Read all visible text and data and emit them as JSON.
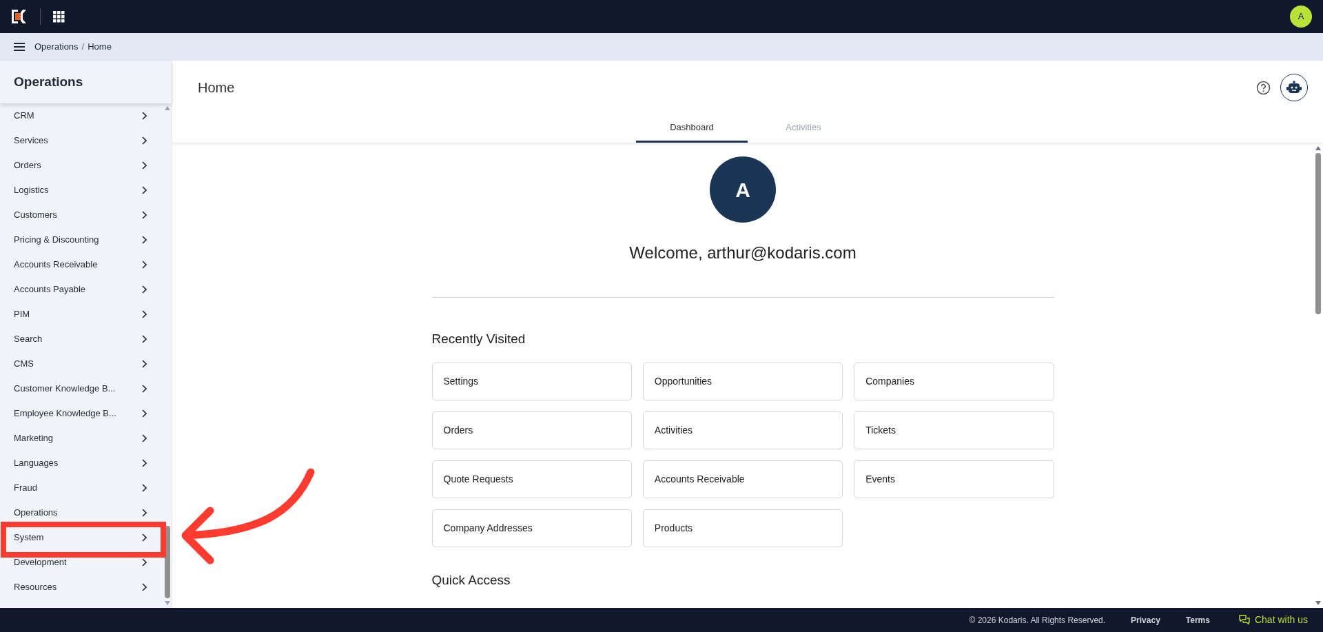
{
  "top_bar": {
    "user_initial": "A"
  },
  "breadcrumb": {
    "items": [
      "Operations",
      "Home"
    ],
    "separator": "/"
  },
  "sidebar": {
    "title": "Operations",
    "items": [
      "CRM",
      "Services",
      "Orders",
      "Logistics",
      "Customers",
      "Pricing & Discounting",
      "Accounts Receivable",
      "Accounts Payable",
      "PIM",
      "Search",
      "CMS",
      "Customer Knowledge B...",
      "Employee Knowledge B...",
      "Marketing",
      "Languages",
      "Fraud",
      "Operations",
      "System",
      "Development",
      "Resources"
    ]
  },
  "page": {
    "title": "Home"
  },
  "tabs": [
    {
      "label": "Dashboard",
      "selected": true
    },
    {
      "label": "Activities",
      "selected": false
    }
  ],
  "dashboard": {
    "avatar_initial": "A",
    "welcome": "Welcome, arthur@kodaris.com",
    "recently_visited": {
      "title": "Recently Visited",
      "links": [
        "Settings",
        "Opportunities",
        "Companies",
        "Orders",
        "Activities",
        "Tickets",
        "Quote Requests",
        "Accounts Receivable",
        "Events",
        "Company Addresses",
        "Products"
      ]
    },
    "quick_access": {
      "title": "Quick Access"
    }
  },
  "footer": {
    "copyright": "© 2026 Kodaris. All Rights Reserved.",
    "links": [
      "Privacy",
      "Terms"
    ],
    "chat": "Chat with us"
  }
}
